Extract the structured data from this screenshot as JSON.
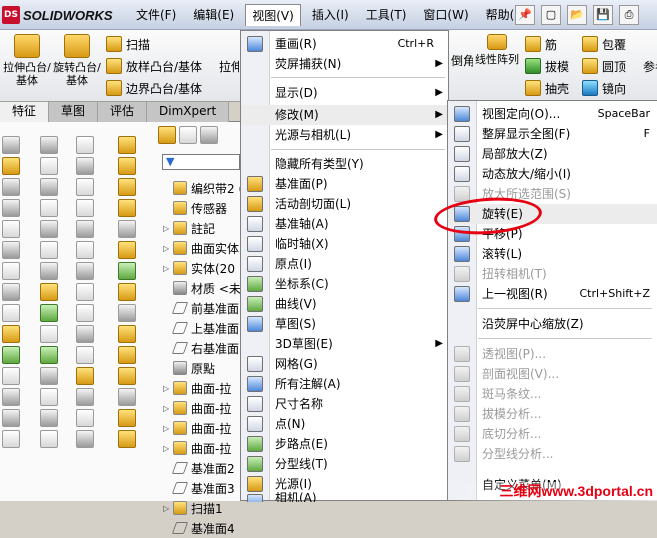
{
  "app": {
    "logo_text": "SOLIDWORKS",
    "logo_badge": "DS"
  },
  "menubar": [
    {
      "label": "文件(F)"
    },
    {
      "label": "编辑(E)"
    },
    {
      "label": "视图(V)"
    },
    {
      "label": "插入(I)"
    },
    {
      "label": "工具(T)"
    },
    {
      "label": "窗口(W)"
    },
    {
      "label": "帮助(H)"
    }
  ],
  "commands": {
    "extrude": "拉伸凸台/基体",
    "revolve": "旋转凸台/基体",
    "sweep": "扫描",
    "loft": "放样凸台/基体",
    "boundary": "边界凸台/基体",
    "partial_label": "拉伸",
    "linear_pattern": "线性阵列",
    "fillet_partial": "倒角",
    "rib": "筋",
    "draft": "拔模",
    "shell": "抽壳",
    "wrap": "包覆",
    "dome": "圆顶",
    "mirror": "镜向",
    "ref_partial": "参考"
  },
  "tabs": [
    "特征",
    "草图",
    "评估",
    "DimXpert"
  ],
  "tree": [
    {
      "label": "编织带2 (默"
    },
    {
      "label": "传感器"
    },
    {
      "label": "註記"
    },
    {
      "label": "曲面实体"
    },
    {
      "label": "实体(20"
    },
    {
      "label": "材质 <未"
    },
    {
      "label": "前基准面"
    },
    {
      "label": "上基准面"
    },
    {
      "label": "右基准面"
    },
    {
      "label": "原點"
    },
    {
      "label": "曲面-拉"
    },
    {
      "label": "曲面-拉"
    },
    {
      "label": "曲面-拉"
    },
    {
      "label": "曲面-拉"
    },
    {
      "label": "基准面2"
    },
    {
      "label": "基准面3"
    },
    {
      "label": "扫描1"
    },
    {
      "label": "基准面4"
    }
  ],
  "view_menu": [
    {
      "label": "重画(R)",
      "shortcut": "Ctrl+R"
    },
    {
      "label": "荧屏捕获(N)",
      "submenu": true
    },
    {
      "label": "显示(D)",
      "submenu": true
    },
    {
      "label": "修改(M)",
      "submenu": true
    },
    {
      "label": "光源与相机(L)",
      "submenu": true
    },
    {
      "label": "隐藏所有类型(Y)"
    },
    {
      "label": "基准面(P)"
    },
    {
      "label": "活动剖切面(L)"
    },
    {
      "label": "基准轴(A)"
    },
    {
      "label": "临时轴(X)"
    },
    {
      "label": "原点(I)"
    },
    {
      "label": "坐标系(C)"
    },
    {
      "label": "曲线(V)"
    },
    {
      "label": "草图(S)"
    },
    {
      "label": "3D草图(E)",
      "submenu": true
    },
    {
      "label": "网格(G)"
    },
    {
      "label": "所有注解(A)"
    },
    {
      "label": "尺寸名称"
    },
    {
      "label": "点(N)"
    },
    {
      "label": "步路点(E)"
    },
    {
      "label": "分型线(T)"
    },
    {
      "label": "光源(I)"
    },
    {
      "label": "相机(A)"
    }
  ],
  "modify_submenu": [
    {
      "label": "视图定向(O)...",
      "shortcut": "SpaceBar"
    },
    {
      "label": "整屏显示全图(F)",
      "shortcut": "F"
    },
    {
      "label": "局部放大(Z)"
    },
    {
      "label": "动态放大/缩小(I)"
    },
    {
      "label": "放大所选范围(S)",
      "disabled": true
    },
    {
      "label": "旋转(E)"
    },
    {
      "label": "平移(P)"
    },
    {
      "label": "滚转(L)"
    },
    {
      "label": "扭转相机(T)",
      "disabled": true
    },
    {
      "label": "上一视图(R)",
      "shortcut": "Ctrl+Shift+Z"
    },
    {
      "label": "沿荧屏中心缩放(Z)"
    },
    {
      "label": "透视图(P)...",
      "disabled": true
    },
    {
      "label": "剖面视图(V)...",
      "disabled": true
    },
    {
      "label": "斑马条纹...",
      "disabled": true
    },
    {
      "label": "拔模分析...",
      "disabled": true
    },
    {
      "label": "底切分析...",
      "disabled": true
    },
    {
      "label": "分型线分析...",
      "disabled": true
    },
    {
      "label": "自定义菜单(M)"
    }
  ],
  "watermark": "三维网www.3dportal.cn",
  "colors": {
    "highlight_circle": "#e60012",
    "accent_yellow": "#f5c000"
  }
}
